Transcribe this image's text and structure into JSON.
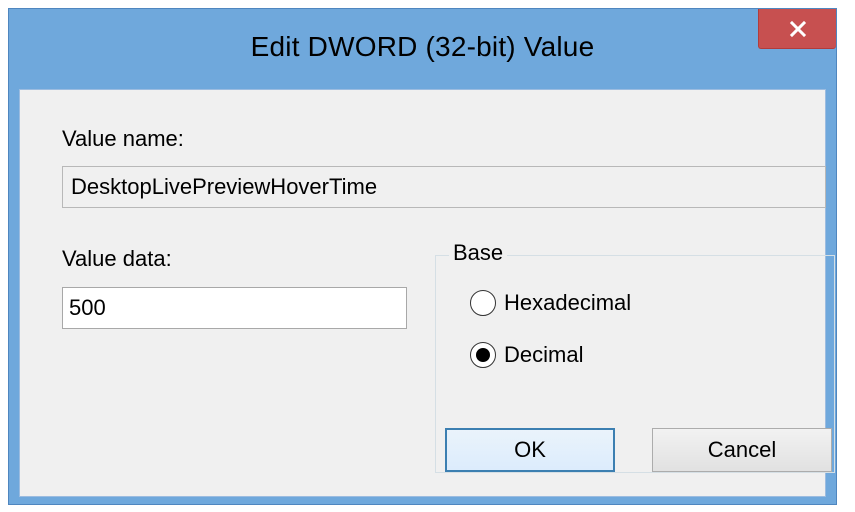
{
  "window": {
    "title": "Edit DWORD (32-bit) Value",
    "close_icon": "close-icon"
  },
  "value_name": {
    "label": "Value name:",
    "value": "DesktopLivePreviewHoverTime"
  },
  "value_data": {
    "label": "Value data:",
    "value": "500"
  },
  "base": {
    "label": "Base",
    "options": [
      {
        "label": "Hexadecimal",
        "selected": false
      },
      {
        "label": "Decimal",
        "selected": true
      }
    ]
  },
  "buttons": {
    "ok": "OK",
    "cancel": "Cancel"
  },
  "colors": {
    "frame": "#6fa8dc",
    "close_button": "#c75050",
    "client": "#f0f0f0",
    "default_button_border": "#3c7fb1"
  }
}
